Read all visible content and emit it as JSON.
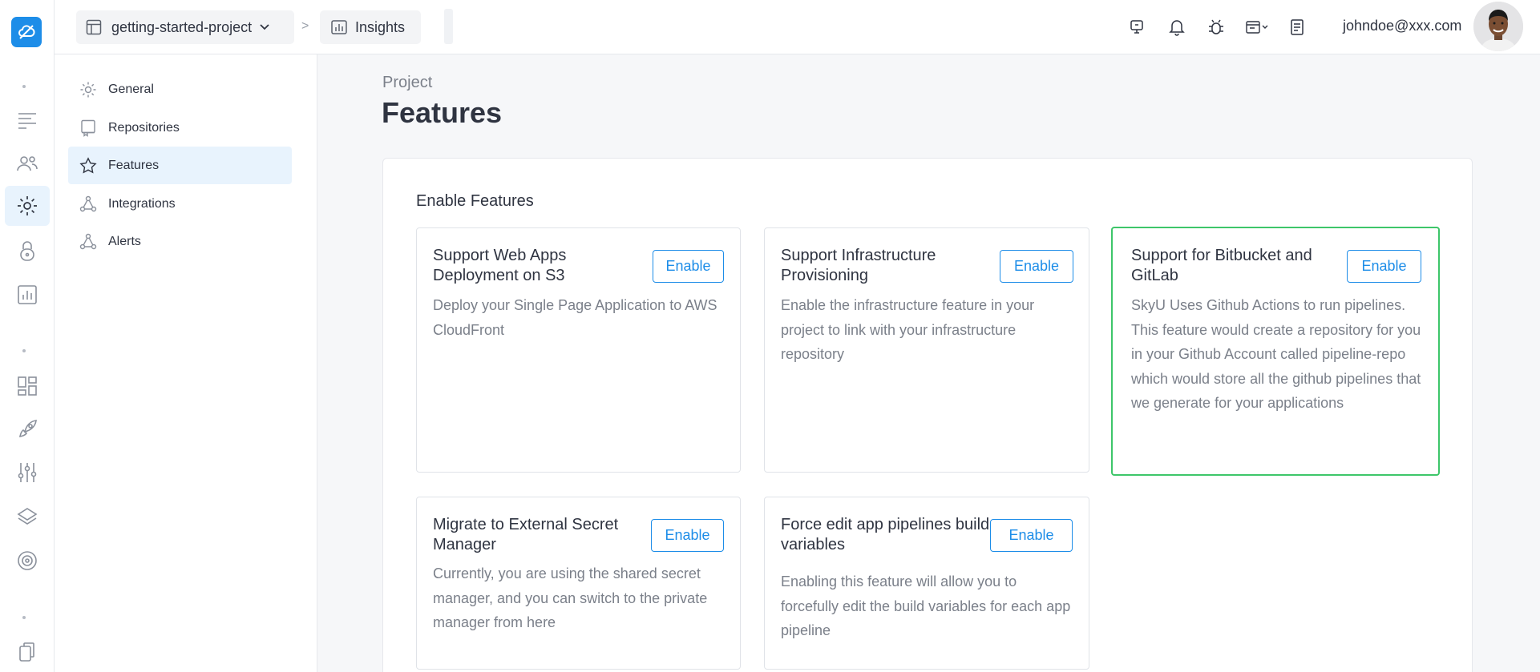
{
  "header": {
    "project": "getting-started-project",
    "separator": ">",
    "current_page": "Insights",
    "user_email": "johndoe@xxx.com"
  },
  "sidebar": {
    "items": [
      {
        "label": "General",
        "icon": "gear-icon"
      },
      {
        "label": "Repositories",
        "icon": "repository-icon"
      },
      {
        "label": "Features",
        "icon": "star-icon",
        "active": true
      },
      {
        "label": "Integrations",
        "icon": "integrations-icon"
      },
      {
        "label": "Alerts",
        "icon": "alerts-icon"
      }
    ]
  },
  "rail": {
    "icons": [
      "list-icon",
      "users-icon",
      "settings-icon",
      "lock-icon",
      "chart-icon",
      "apps-icon",
      "rocket-icon",
      "sliders-icon",
      "layers-icon",
      "shield-icon",
      "copy-icon"
    ],
    "active": "settings-icon"
  },
  "main": {
    "subtitle": "Project",
    "title": "Features",
    "panel_title": "Enable Features",
    "features": [
      {
        "title": "Support Web Apps Deployment on S3",
        "description": "Deploy your Single Page Application to AWS CloudFront",
        "button": "Enable"
      },
      {
        "title": "Support Infrastructure Provisioning",
        "description": "Enable the infrastructure feature in your project to link with your infrastructure repository",
        "button": "Enable"
      },
      {
        "title": "Support for Bitbucket and GitLab",
        "description": "SkyU Uses Github Actions to run pipelines. This feature would create a repository for you in your Github Account called pipeline-repo which would store all the github pipelines that we generate for your applications",
        "button": "Enable",
        "highlighted": true
      },
      {
        "title": "Migrate to External Secret Manager",
        "description": "Currently, you are using the shared secret manager, and you can switch to the private manager from here",
        "button": "Enable"
      },
      {
        "title": "Force edit app pipelines build variables",
        "description": "Enabling this feature will allow you to forcefully edit the build variables for each app pipeline",
        "button": "Enable"
      }
    ]
  },
  "colors": {
    "accent": "#1d8de8",
    "highlight_border": "#3ec66a",
    "active_bg": "#e8f3fd"
  }
}
